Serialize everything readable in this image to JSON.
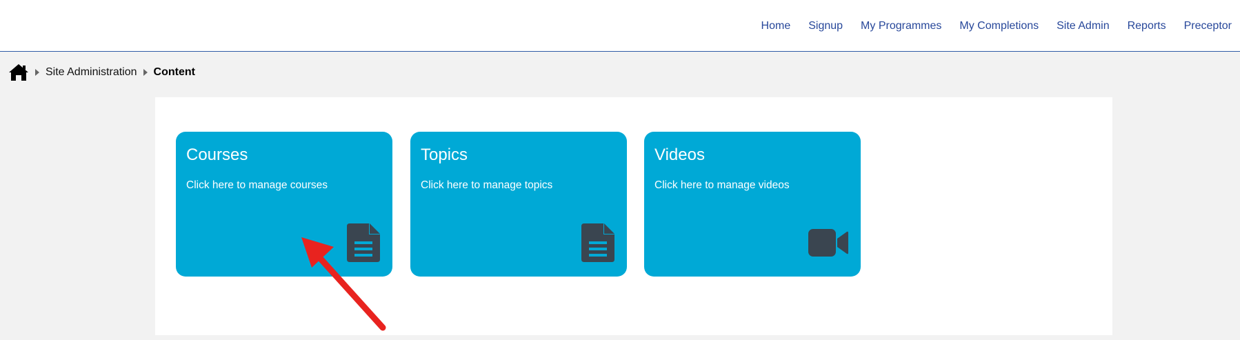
{
  "nav": {
    "items": [
      {
        "label": "Home"
      },
      {
        "label": "Signup"
      },
      {
        "label": "My Programmes"
      },
      {
        "label": "My Completions"
      },
      {
        "label": "Site Admin"
      },
      {
        "label": "Reports"
      },
      {
        "label": "Preceptor"
      }
    ]
  },
  "breadcrumb": {
    "home_icon": "home-icon",
    "items": [
      {
        "label": "Site Administration"
      },
      {
        "label": "Content"
      }
    ]
  },
  "cards": [
    {
      "title": "Courses",
      "description": "Click here to manage courses",
      "icon": "document-icon"
    },
    {
      "title": "Topics",
      "description": "Click here to manage topics",
      "icon": "document-icon"
    },
    {
      "title": "Videos",
      "description": "Click here to manage videos",
      "icon": "video-camera-icon"
    }
  ],
  "colors": {
    "card_background": "#00a9d6",
    "icon_color": "#3a4550",
    "nav_link": "#27479a",
    "annotation_arrow": "#e8231f"
  },
  "annotation": {
    "icon": "red-arrow"
  }
}
